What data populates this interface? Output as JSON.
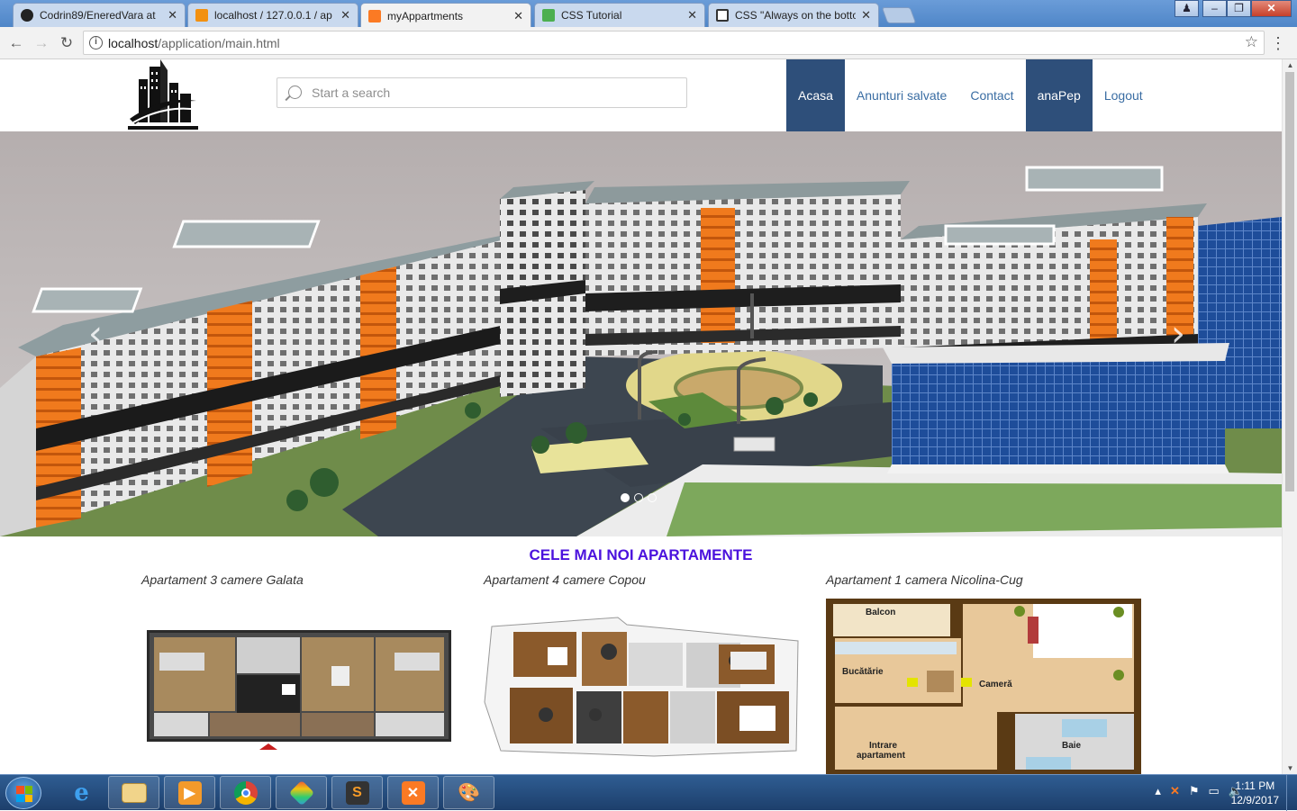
{
  "browser": {
    "tabs": [
      {
        "title": "Codrin89/EneredVara at",
        "icon": "github-icon",
        "color": "#222222"
      },
      {
        "title": "localhost / 127.0.0.1 / ap",
        "icon": "phpmyadmin-icon",
        "color": "#f29111"
      },
      {
        "title": "myAppartments",
        "icon": "xampp-icon",
        "color": "#fb7a24"
      },
      {
        "title": "CSS Tutorial",
        "icon": "w3schools-icon",
        "color": "#4caf50"
      },
      {
        "title": "CSS \"Always on the botto",
        "icon": "codepen-icon",
        "color": "#333333"
      }
    ],
    "url_host": "localhost",
    "url_path": "/application/main.html"
  },
  "header": {
    "search_placeholder": "Start a search",
    "nav": [
      {
        "label": "Acasa",
        "active": true
      },
      {
        "label": "Anunturi salvate",
        "active": false
      },
      {
        "label": "Contact",
        "active": false
      },
      {
        "label": "anaPep",
        "active": true
      },
      {
        "label": "Logout",
        "active": false
      }
    ]
  },
  "carousel": {
    "slides": 3,
    "active_slide": 1,
    "prev_icon": "chevron-left-icon",
    "next_icon": "chevron-right-icon"
  },
  "listings": {
    "title": "CELE MAI NOI APARTAMENTE",
    "items": [
      {
        "title": "Apartament 3 camere Galata"
      },
      {
        "title": "Apartament 4 camere Copou"
      },
      {
        "title": "Apartament 1 camera Nicolina-Cug",
        "plan_labels": {
          "balcony": "Balcon",
          "kitchen": "Bucătărie",
          "room": "Cameră",
          "bath": "Baie",
          "entrance_1": "Intrare",
          "entrance_2": "apartament"
        }
      }
    ]
  },
  "taskbar": {
    "time": "1:11 PM",
    "date": "12/9/2017",
    "apps": [
      "ie-icon",
      "explorer-icon",
      "media-player-icon",
      "chrome-icon",
      "paint-icon",
      "sublime-icon",
      "xampp-icon",
      "paint-palette-icon"
    ]
  },
  "colors": {
    "nav_active": "#2e4f7a",
    "nav_link": "#3a6da3",
    "section_title": "#4b12dd"
  }
}
